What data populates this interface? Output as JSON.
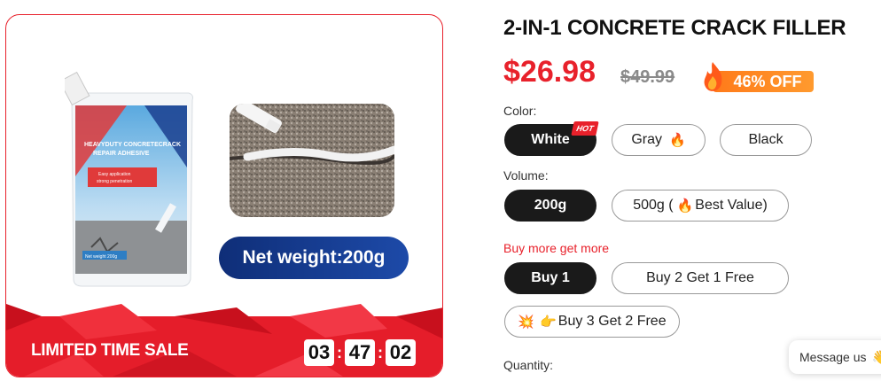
{
  "gallery": {
    "pouch_text": {
      "title_line1": "HEAVYDUTY CONCRETECRACK",
      "title_line2": "REPAIR ADHESIVE",
      "sub1": "Easy application",
      "sub2": "strong penetration",
      "weight": "Net weight 200g"
    },
    "weight_pill": "Net weight:200g",
    "sale_label": "LIMITED TIME SALE",
    "timer": {
      "hours": "03",
      "minutes": "47",
      "seconds": "02"
    }
  },
  "product": {
    "title": "2-IN-1 CONCRETE CRACK FILLER",
    "price": "$26.98",
    "old_price": "$49.99",
    "discount": "46% OFF"
  },
  "color": {
    "label": "Color:",
    "hot_tag": "HOT",
    "options": [
      {
        "label": "White",
        "selected": true
      },
      {
        "label": "Gray",
        "selected": false
      },
      {
        "label": "Black",
        "selected": false
      }
    ]
  },
  "volume": {
    "label": "Volume:",
    "options": [
      {
        "label": "200g",
        "selected": true
      },
      {
        "label_pre": "500g (",
        "label_post": "Best Value)",
        "selected": false
      }
    ]
  },
  "bundle": {
    "label": "Buy more get more",
    "options": [
      {
        "label": "Buy 1",
        "selected": true
      },
      {
        "label": "Buy 2 Get 1 Free",
        "selected": false
      },
      {
        "label": "Buy 3 Get 2 Free",
        "selected": false
      }
    ]
  },
  "quantity": {
    "label": "Quantity:"
  },
  "chat": {
    "label": "Message us"
  },
  "colors": {
    "accent": "#e8212b",
    "dark": "#1a1a1a",
    "navy": "#0f2e78",
    "orange": "#ff8a20"
  },
  "icons": [
    "fire-icon",
    "fire-icon",
    "sparkle-icon",
    "pointing-hand-icon",
    "hand-wave-icon"
  ]
}
